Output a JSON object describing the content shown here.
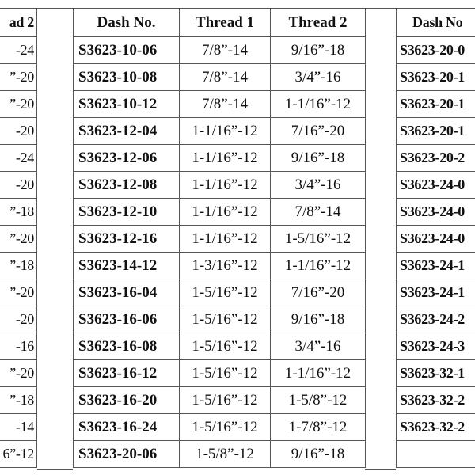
{
  "left_table": {
    "header": "ad 2",
    "rows": [
      "-24",
      "”-20",
      "”-20",
      "-20",
      "-24",
      "-20",
      "”-18",
      "”-20",
      "”-18",
      "”-20",
      "-20",
      "-16",
      "”-20",
      "”-18",
      "-14",
      "6”-12"
    ]
  },
  "middle_table": {
    "headers": [
      "Dash No.",
      "Thread 1",
      "Thread 2"
    ],
    "rows": [
      [
        "S3623-10-06",
        "7/8”-14",
        "9/16”-18"
      ],
      [
        "S3623-10-08",
        "7/8”-14",
        "3/4”-16"
      ],
      [
        "S3623-10-12",
        "7/8”-14",
        "1-1/16”-12"
      ],
      [
        "S3623-12-04",
        "1-1/16”-12",
        "7/16”-20"
      ],
      [
        "S3623-12-06",
        "1-1/16”-12",
        "9/16”-18"
      ],
      [
        "S3623-12-08",
        "1-1/16”-12",
        "3/4”-16"
      ],
      [
        "S3623-12-10",
        "1-1/16”-12",
        "7/8”-14"
      ],
      [
        "S3623-12-16",
        "1-1/16”-12",
        "1-5/16”-12"
      ],
      [
        "S3623-14-12",
        "1-3/16”-12",
        "1-1/16”-12"
      ],
      [
        "S3623-16-04",
        "1-5/16”-12",
        "7/16”-20"
      ],
      [
        "S3623-16-06",
        "1-5/16”-12",
        "9/16”-18"
      ],
      [
        "S3623-16-08",
        "1-5/16”-12",
        "3/4”-16"
      ],
      [
        "S3623-16-12",
        "1-5/16”-12",
        "1-1/16”-12"
      ],
      [
        "S3623-16-20",
        "1-5/16”-12",
        "1-5/8”-12"
      ],
      [
        "S3623-16-24",
        "1-5/16”-12",
        "1-7/8”-12"
      ],
      [
        "S3623-20-06",
        "1-5/8”-12",
        "9/16”-18"
      ]
    ]
  },
  "right_table": {
    "header": "Dash No",
    "rows": [
      "S3623-20-0",
      "S3623-20-1",
      "S3623-20-1",
      "S3623-20-1",
      "S3623-20-2",
      "S3623-24-0",
      "S3623-24-0",
      "S3623-24-0",
      "S3623-24-1",
      "S3623-24-1",
      "S3623-24-2",
      "S3623-24-3",
      "S3623-32-1",
      "S3623-32-2",
      "S3623-32-2",
      ""
    ]
  }
}
